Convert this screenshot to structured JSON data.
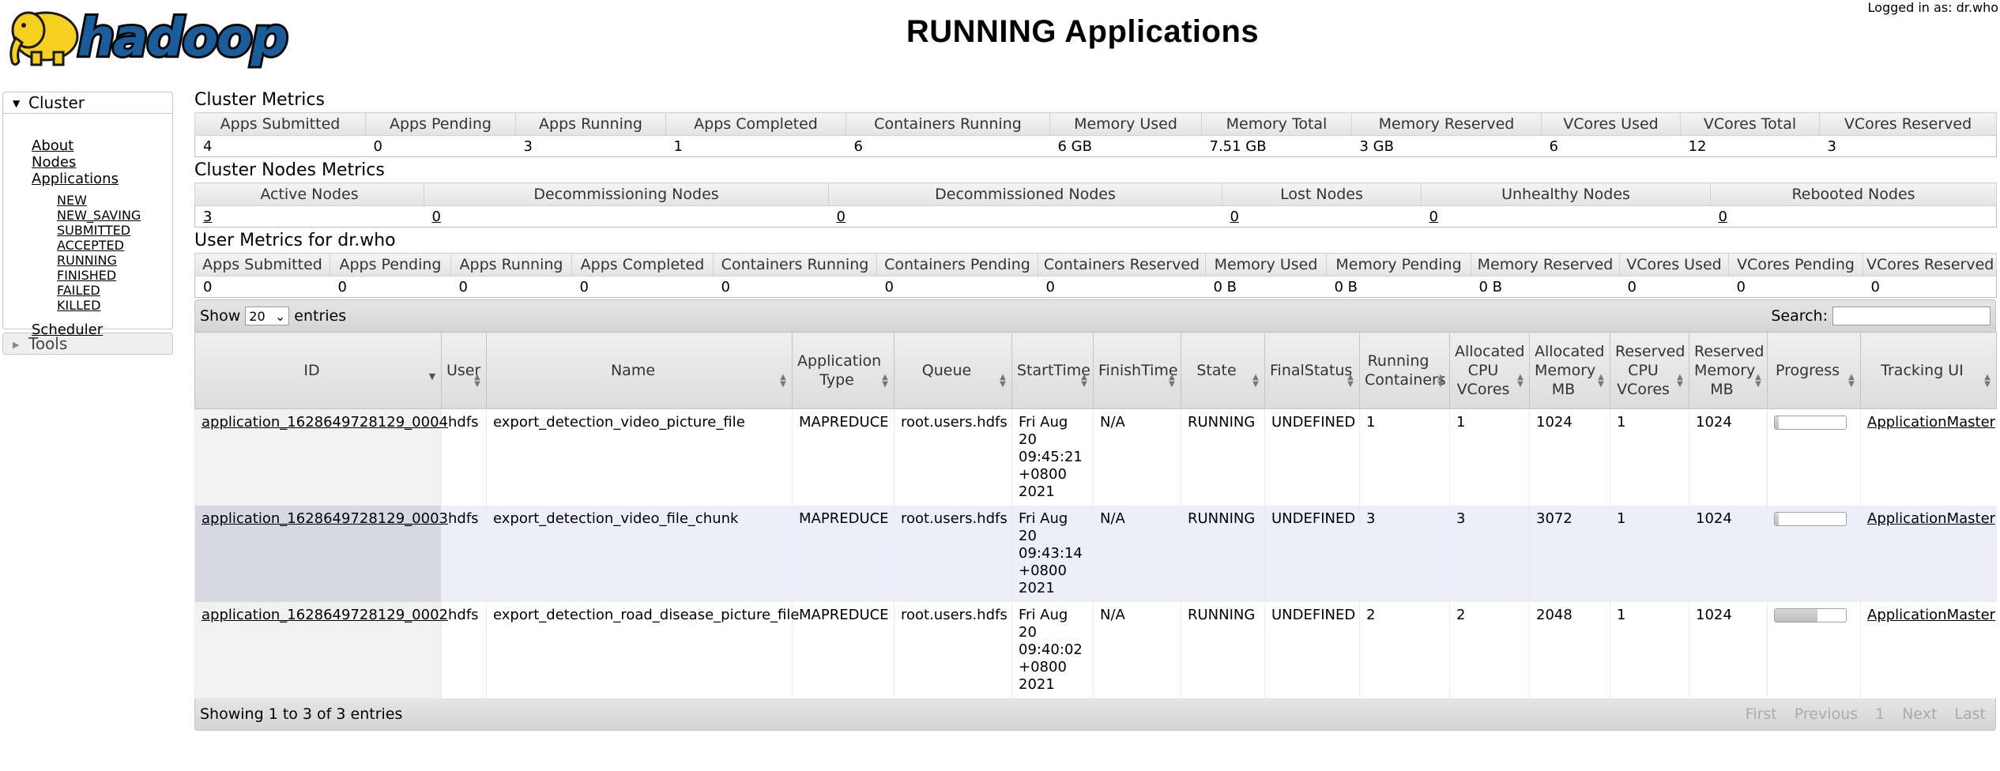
{
  "header": {
    "logo_text": "hadoop",
    "title": "RUNNING Applications",
    "logged_in": "Logged in as: dr.who"
  },
  "sidebar": {
    "cluster": {
      "label": "Cluster",
      "items": [
        {
          "label": "About"
        },
        {
          "label": "Nodes"
        },
        {
          "label": "Applications"
        }
      ],
      "app_states": [
        "NEW",
        "NEW_SAVING",
        "SUBMITTED",
        "ACCEPTED",
        "RUNNING",
        "FINISHED",
        "FAILED",
        "KILLED"
      ],
      "scheduler": "Scheduler"
    },
    "tools": {
      "label": "Tools"
    }
  },
  "cluster_metrics": {
    "title": "Cluster Metrics",
    "headers": [
      "Apps Submitted",
      "Apps Pending",
      "Apps Running",
      "Apps Completed",
      "Containers Running",
      "Memory Used",
      "Memory Total",
      "Memory Reserved",
      "VCores Used",
      "VCores Total",
      "VCores Reserved"
    ],
    "values": [
      "4",
      "0",
      "3",
      "1",
      "6",
      "6 GB",
      "7.51 GB",
      "3 GB",
      "6",
      "12",
      "3"
    ]
  },
  "cluster_nodes_metrics": {
    "title": "Cluster Nodes Metrics",
    "headers": [
      "Active Nodes",
      "Decommissioning Nodes",
      "Decommissioned Nodes",
      "Lost Nodes",
      "Unhealthy Nodes",
      "Rebooted Nodes"
    ],
    "values": [
      "3",
      "0",
      "0",
      "0",
      "0",
      "0"
    ]
  },
  "user_metrics": {
    "title": "User Metrics for dr.who",
    "headers": [
      "Apps Submitted",
      "Apps Pending",
      "Apps Running",
      "Apps Completed",
      "Containers Running",
      "Containers Pending",
      "Containers Reserved",
      "Memory Used",
      "Memory Pending",
      "Memory Reserved",
      "VCores Used",
      "VCores Pending",
      "VCores Reserved"
    ],
    "values": [
      "0",
      "0",
      "0",
      "0",
      "0",
      "0",
      "0",
      "0 B",
      "0 B",
      "0 B",
      "0",
      "0",
      "0"
    ]
  },
  "apps_table": {
    "show_label": "Show",
    "page_size": "20",
    "entries_label": "entries",
    "search_label": "Search:",
    "search_value": "",
    "columns": [
      "ID",
      "User",
      "Name",
      "Application Type",
      "Queue",
      "StartTime",
      "FinishTime",
      "State",
      "FinalStatus",
      "Running Containers",
      "Allocated CPU VCores",
      "Allocated Memory MB",
      "Reserved CPU VCores",
      "Reserved Memory MB",
      "Progress",
      "Tracking UI"
    ],
    "rows": [
      {
        "id": "application_1628649728129_0004",
        "user": "hdfs",
        "name": "export_detection_video_picture_file",
        "type": "MAPREDUCE",
        "queue": "root.users.hdfs",
        "start": [
          "Fri Aug",
          "20",
          "09:45:21",
          "+0800",
          "2021"
        ],
        "finish": "N/A",
        "state": "RUNNING",
        "final_status": "UNDEFINED",
        "running_containers": "1",
        "alloc_vcores": "1",
        "alloc_mem": "1024",
        "res_vcores": "1",
        "res_mem": "1024",
        "progress": 0.05,
        "tracking": "ApplicationMaster"
      },
      {
        "id": "application_1628649728129_0003",
        "user": "hdfs",
        "name": "export_detection_video_file_chunk",
        "type": "MAPREDUCE",
        "queue": "root.users.hdfs",
        "start": [
          "Fri Aug",
          "20",
          "09:43:14",
          "+0800",
          "2021"
        ],
        "finish": "N/A",
        "state": "RUNNING",
        "final_status": "UNDEFINED",
        "running_containers": "3",
        "alloc_vcores": "3",
        "alloc_mem": "3072",
        "res_vcores": "1",
        "res_mem": "1024",
        "progress": 0.05,
        "tracking": "ApplicationMaster"
      },
      {
        "id": "application_1628649728129_0002",
        "user": "hdfs",
        "name": "export_detection_road_disease_picture_file",
        "type": "MAPREDUCE",
        "queue": "root.users.hdfs",
        "start": [
          "Fri Aug",
          "20",
          "09:40:02",
          "+0800",
          "2021"
        ],
        "finish": "N/A",
        "state": "RUNNING",
        "final_status": "UNDEFINED",
        "running_containers": "2",
        "alloc_vcores": "2",
        "alloc_mem": "2048",
        "res_vcores": "1",
        "res_mem": "1024",
        "progress": 0.6,
        "tracking": "ApplicationMaster"
      }
    ],
    "info": "Showing 1 to 3 of 3 entries",
    "pager": [
      "First",
      "Previous",
      "1",
      "Next",
      "Last"
    ]
  }
}
